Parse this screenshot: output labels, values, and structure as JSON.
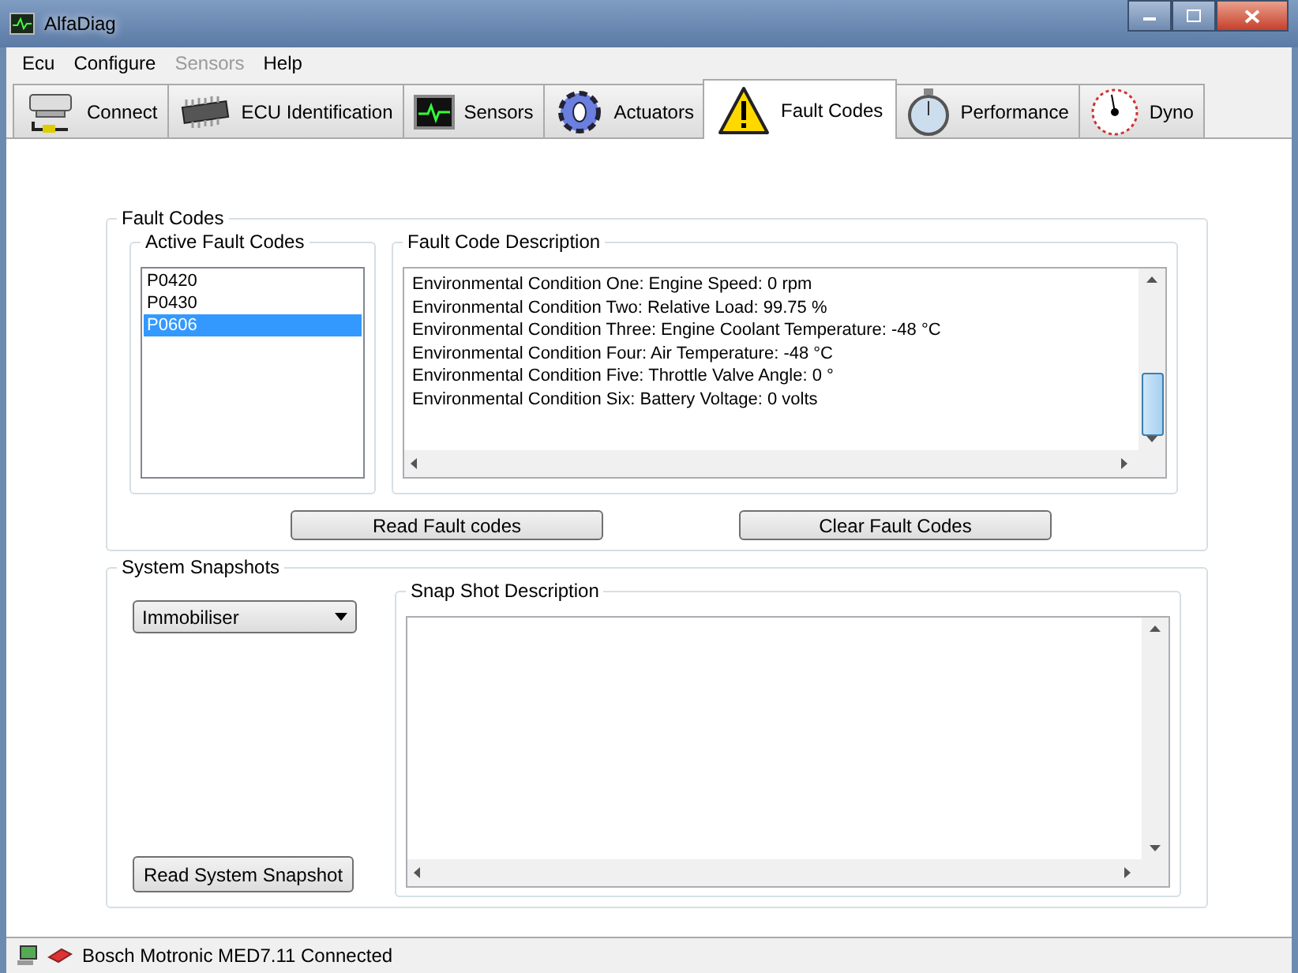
{
  "window": {
    "title": "AlfaDiag"
  },
  "menu": [
    {
      "label": "Ecu",
      "disabled": false
    },
    {
      "label": "Configure",
      "disabled": false
    },
    {
      "label": "Sensors",
      "disabled": true
    },
    {
      "label": "Help",
      "disabled": false
    }
  ],
  "tabs": [
    {
      "label": "Connect",
      "selected": false
    },
    {
      "label": "ECU Identification",
      "selected": false
    },
    {
      "label": "Sensors",
      "selected": false
    },
    {
      "label": "Actuators",
      "selected": false
    },
    {
      "label": "Fault Codes",
      "selected": true
    },
    {
      "label": "Performance",
      "selected": false
    },
    {
      "label": "Dyno",
      "selected": false
    }
  ],
  "fault_codes": {
    "title": "Fault Codes",
    "active_title": "Active Fault Codes",
    "codes": [
      {
        "code": "P0420",
        "selected": false
      },
      {
        "code": "P0430",
        "selected": false
      },
      {
        "code": "P0606",
        "selected": true
      }
    ],
    "description_title": "Fault Code Description",
    "description_lines": [
      "Environmental Condition One: Engine Speed: 0 rpm",
      "Environmental Condition Two: Relative Load: 99.75 %",
      "Environmental Condition Three: Engine Coolant Temperature: -48 °C",
      "Environmental Condition Four: Air Temperature: -48 °C",
      "Environmental Condition Five: Throttle Valve Angle: 0 °",
      "Environmental Condition Six: Battery Voltage: 0 volts"
    ],
    "buttons": [
      "Read Fault codes",
      "Clear Fault Codes"
    ]
  },
  "snapshots": {
    "title": "System Snapshots",
    "dropdown": "Immobiliser",
    "description_title": "Snap Shot Description",
    "button": "Read System Snapshot"
  },
  "status_bar": {
    "text": "Bosch Motronic MED7.11 Connected"
  }
}
